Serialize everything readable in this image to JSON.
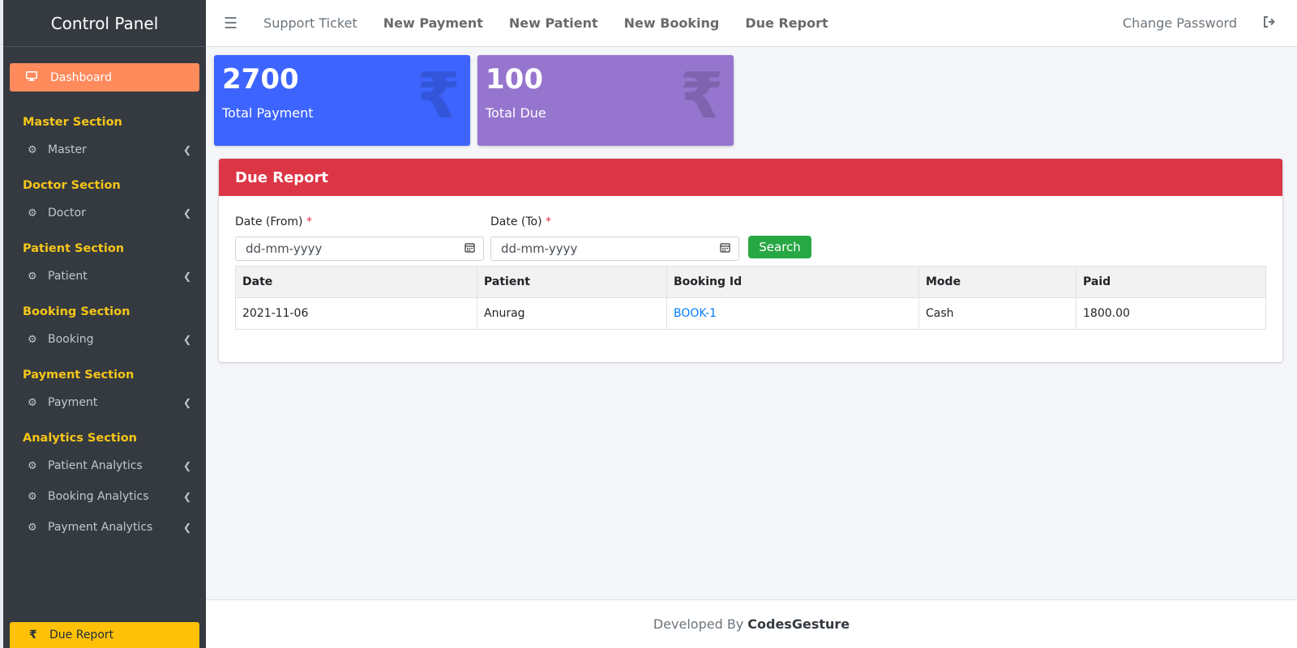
{
  "sidebar": {
    "brand": "Control Panel",
    "dashboard": {
      "icon": "monitor-icon",
      "label": "Dashboard"
    },
    "sections": [
      {
        "title": "Master Section",
        "items": [
          {
            "label": "Master"
          }
        ]
      },
      {
        "title": "Doctor Section",
        "items": [
          {
            "label": "Doctor"
          }
        ]
      },
      {
        "title": "Patient Section",
        "items": [
          {
            "label": "Patient"
          }
        ]
      },
      {
        "title": "Booking Section",
        "items": [
          {
            "label": "Booking"
          }
        ]
      },
      {
        "title": "Payment Section",
        "items": [
          {
            "label": "Payment"
          }
        ]
      },
      {
        "title": "Analytics Section",
        "items": [
          {
            "label": "Patient Analytics"
          },
          {
            "label": "Booking Analytics"
          },
          {
            "label": "Payment Analytics"
          }
        ]
      }
    ],
    "due_report": {
      "icon": "rupee-icon",
      "label": "Due Report"
    }
  },
  "topbar": {
    "links": [
      "Support Ticket",
      "New Payment",
      "New Patient",
      "New Booking",
      "Due Report"
    ],
    "change_password": "Change Password"
  },
  "stats": [
    {
      "value": "2700",
      "label": "Total Payment",
      "color": "#3d64ff",
      "icon": "rupee-icon"
    },
    {
      "value": "100",
      "label": "Total Due",
      "color": "#9675ce",
      "icon": "rupee-icon"
    }
  ],
  "report": {
    "title": "Due Report",
    "date_from_label": "Date (From)",
    "date_to_label": "Date (To)",
    "required_mark": "*",
    "date_placeholder": "dd-mm-yyyy",
    "search_label": "Search",
    "columns": [
      "Date",
      "Patient",
      "Booking Id",
      "Mode",
      "Paid"
    ],
    "rows": [
      {
        "date": "2021-11-06",
        "patient": "Anurag",
        "booking_id": "BOOK-1",
        "mode": "Cash",
        "paid": "1800.00"
      }
    ]
  },
  "footer": {
    "prefix": "Developed By",
    "company": "CodesGesture"
  },
  "colors": {
    "sidebar": "#343a40",
    "accent_orange": "#ff8a5c",
    "section_yellow": "#f5c518",
    "due_yellow": "#ffc107",
    "report_red": "#dc3545",
    "search_green": "#28a745"
  }
}
